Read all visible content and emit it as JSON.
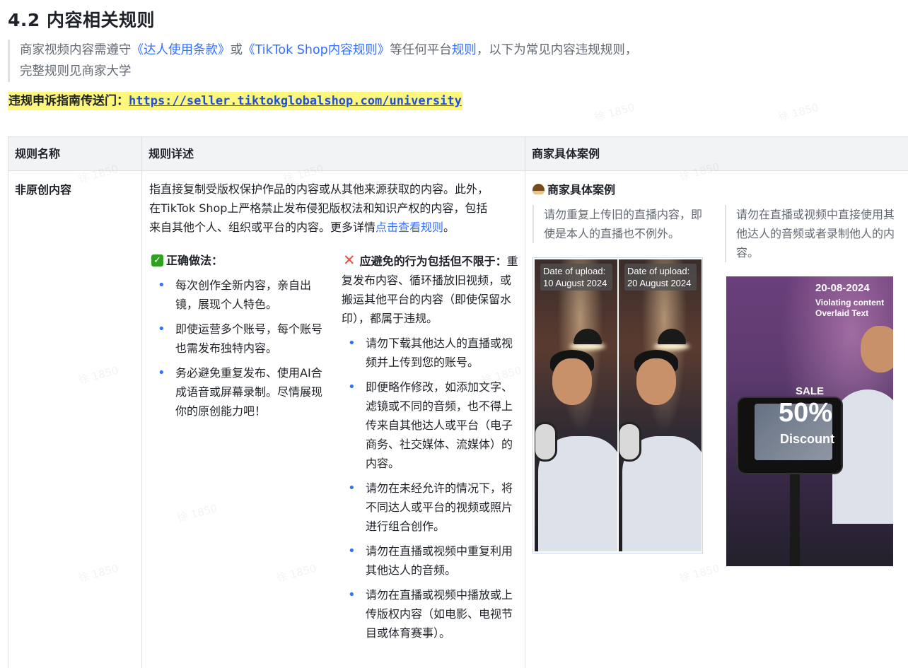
{
  "title": "4.2 内容相关规则",
  "intro": {
    "part1": "商家视频内容需遵守",
    "link1": "《达人使用条款》",
    "part2": "或",
    "link2": "《TikTok Shop内容规则》",
    "part3": "等任何平台",
    "link3": "规则",
    "part4": "，以下为常见内容违规规则，",
    "line2": "完整规则见商家大学"
  },
  "guide": {
    "label": "违规申诉指南传送门：",
    "url": "https://seller.tiktokglobalshop.com/university"
  },
  "table": {
    "headers": [
      "规则名称",
      "规则详述",
      "商家具体案例"
    ],
    "row": {
      "name": "非原创内容",
      "desc_line1": "指直接复制受版权保护作品的内容或从其他来源获取的内容。此外，",
      "desc_line2": "在TikTok Shop上严格禁止发布侵犯版权法和知识产权的内容，包括",
      "desc_line3a": "来自其他个人、组织或平台的内容。更多详情",
      "desc_link": "点击查看规则",
      "desc_line3b": "。",
      "right_heading": "正确做法：",
      "right_items": [
        "每次创作全新内容，亲自出镜，展现个人特色。",
        "即使运营多个账号，每个账号也需发布独特内容。",
        "务必避免重复发布、使用AI合成语音或屏幕录制。尽情展现你的原创能力吧！"
      ],
      "wrong_heading": "应避免的行为包括但不限于：",
      "wrong_intro": "重复发布内容、循环播放旧视频，或搬运其他平台的内容（即使保留水印），都属于违规。",
      "wrong_items": [
        "请勿下载其他达人的直播或视频并上传到您的账号。",
        "即便略作修改，如添加文字、滤镜或不同的音频，也不得上传来自其他达人或平台（电子商务、社交媒体、流媒体）的内容。",
        "请勿在未经允许的情况下，将不同达人或平台的视频或照片进行组合创作。",
        "请勿在直播或视频中重复利用其他达人的音频。",
        "请勿在直播或视频中播放或上传版权内容（如电影、电视节目或体育赛事）。"
      ],
      "case_heading": "商家具体案例",
      "case1": "请勿重复上传旧的直播内容，即使是本人的直播也不例外。",
      "case2": "请勿在直播或视频中直接使用其他达人的音频或者录制他人的内容。",
      "img1_tag_a_line1": "Date of upload:",
      "img1_tag_a_line2": "10 August 2024",
      "img1_tag_b_line1": "Date of upload:",
      "img1_tag_b_line2": "20 August 2024",
      "img2_date": "20-08-2024",
      "img2_note_line1": "Violating content",
      "img2_note_line2": "Overlaid Text",
      "img2_sale": "SALE",
      "img2_pct": "50%",
      "img2_discount": "Discount"
    }
  },
  "watermark": "徐 1850"
}
